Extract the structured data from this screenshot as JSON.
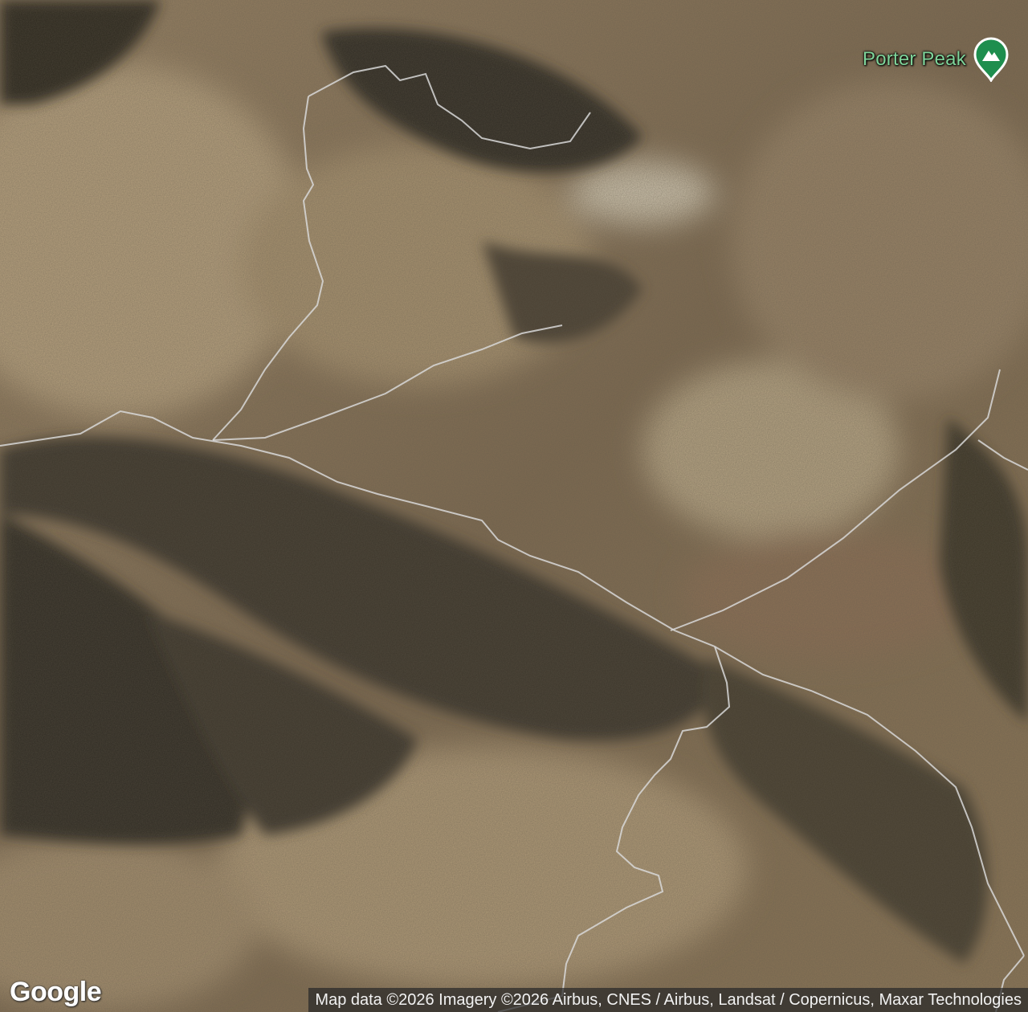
{
  "map": {
    "type": "satellite",
    "places": [
      {
        "name": "Porter Peak",
        "icon": "mountain-peak-icon",
        "label_color": "#7fd49a",
        "marker_color": "#1e8e4e"
      }
    ]
  },
  "branding": {
    "logo": "Google"
  },
  "attribution": "Map data ©2026 Imagery ©2026 Airbus, CNES / Airbus, Landsat / Copernicus, Maxar Technologies",
  "colors": {
    "trail": "#d8d8d8",
    "terrain_light": "#b29c7a",
    "terrain_dark": "#2e2a22"
  }
}
